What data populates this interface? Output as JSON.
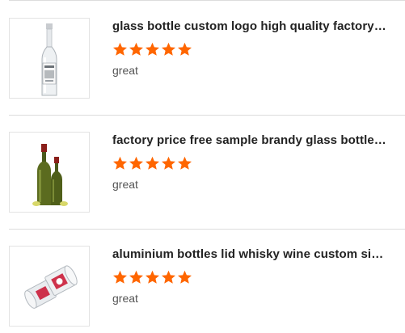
{
  "colors": {
    "star": "#ff6600",
    "divider": "#dcdcdc",
    "title": "#222222",
    "comment": "#555555"
  },
  "reviews": [
    {
      "title": "glass bottle custom logo high quality factory price",
      "rating": 5,
      "comment": "great",
      "image_icon": "clear-glass-bottle-icon"
    },
    {
      "title": "factory price free sample brandy glass bottle high quality",
      "rating": 5,
      "comment": "great",
      "image_icon": "green-glass-bottles-icon"
    },
    {
      "title": "aluminium bottles lid whisky wine custom size logo",
      "rating": 5,
      "comment": "great",
      "image_icon": "aluminium-lids-icon"
    }
  ]
}
